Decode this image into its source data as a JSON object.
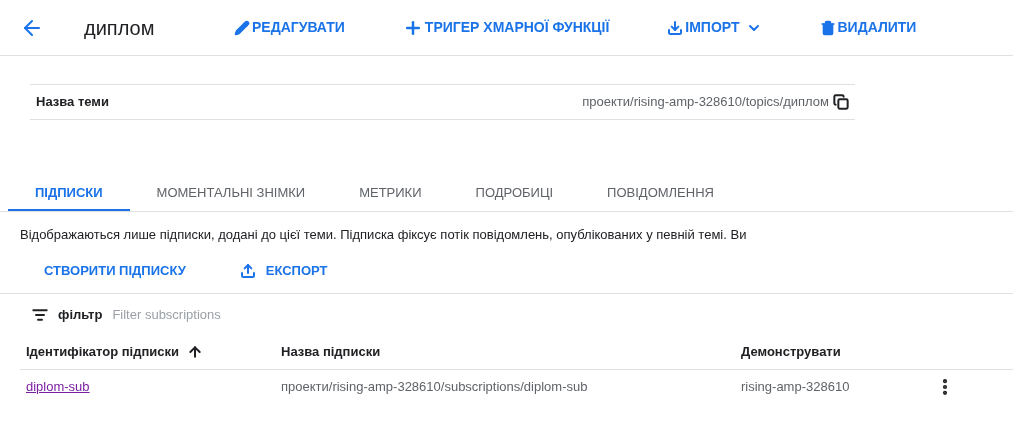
{
  "header": {
    "title": "диплом",
    "actions": [
      {
        "kind": "edit",
        "label": "РЕДАГУВАТИ"
      },
      {
        "kind": "add",
        "label": "ТРИГЕР ХМАРНОЇ ФУНКЦІЇ"
      },
      {
        "kind": "import",
        "label": "ІМПОРТ"
      },
      {
        "kind": "delete",
        "label": "ВИДАЛИТИ"
      }
    ]
  },
  "topic": {
    "label": "Назва теми",
    "value": "проекти/rising-amp-328610/topics/диплом"
  },
  "tabs": [
    {
      "label": "ПІДПИСКИ",
      "selected": true
    },
    {
      "label": "МОМЕНТАЛЬНІ ЗНІМКИ",
      "selected": false
    },
    {
      "label": "МЕТРИКИ",
      "selected": false
    },
    {
      "label": "ПОДРОБИЦІ",
      "selected": false
    },
    {
      "label": "ПОВІДОМЛЕННЯ",
      "selected": false
    }
  ],
  "description": "Відображаються лише підписки, додані до цієї теми. Підписка фіксує потік повідомлень, опублікованих у певній темі. Ви",
  "buttons": [
    {
      "kind": "create",
      "label": "СТВОРИТИ ПІДПИСКУ"
    },
    {
      "kind": "export",
      "label": "ЕКСПОРТ"
    }
  ],
  "filter": {
    "label": "фільтр",
    "placeholder": "Filter subscriptions"
  },
  "table": {
    "columns": [
      "Ідентифікатор підписки",
      "Назва підписки",
      "Демонструвати"
    ],
    "rows": [
      [
        "diplom-sub",
        "проекти/rising-amp-328610/subscriptions/diplom-sub",
        "rising-amp-328610"
      ]
    ]
  }
}
